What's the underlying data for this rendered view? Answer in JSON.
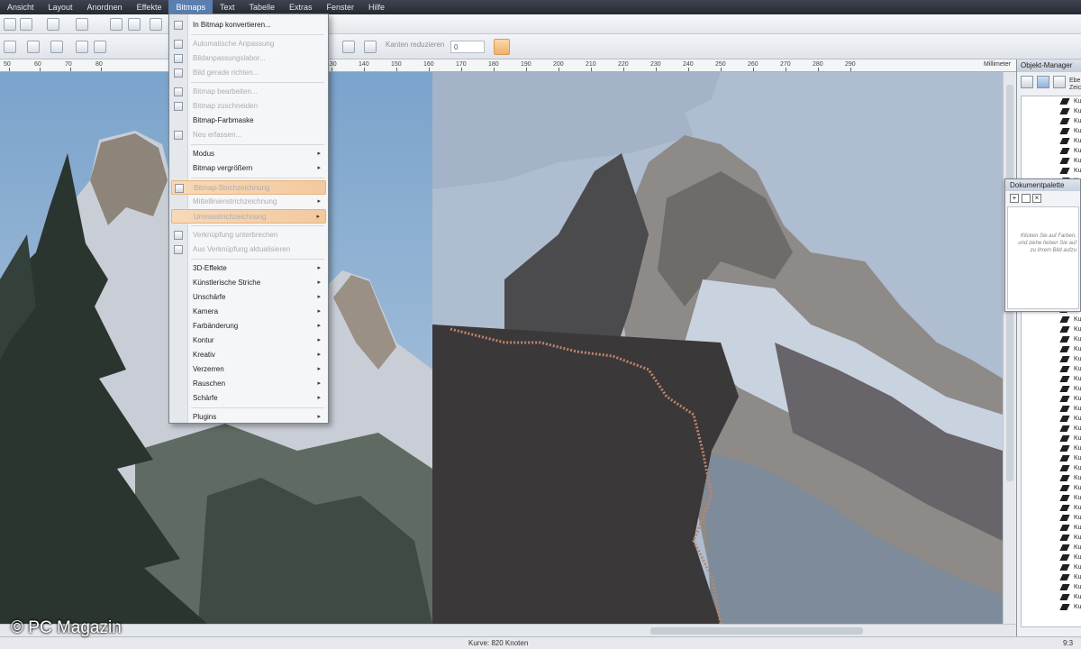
{
  "menubar": {
    "items": [
      "Ansicht",
      "Layout",
      "Anordnen",
      "Effekte",
      "Bitmaps",
      "Text",
      "Tabelle",
      "Extras",
      "Fenster",
      "Hilfe"
    ],
    "active_index": 4
  },
  "toolbar": {
    "smooth_label": "Kanten reduzieren",
    "smooth_value": "0"
  },
  "ruler": {
    "ticks": [
      "50",
      "60",
      "70",
      "80",
      "130",
      "140",
      "150",
      "160",
      "170",
      "180",
      "190",
      "200",
      "210",
      "220",
      "230",
      "240",
      "250",
      "260",
      "270",
      "280",
      "290"
    ],
    "unit": "Millimeter"
  },
  "bitmap_menu": {
    "items": [
      {
        "label": "In Bitmap konvertieren...",
        "enabled": true,
        "submenu": false,
        "icon": true
      },
      {
        "label": "Automatische Anpassung",
        "enabled": false,
        "submenu": false,
        "icon": true
      },
      {
        "label": "Bildanpassungslabor...",
        "enabled": false,
        "submenu": false,
        "icon": true
      },
      {
        "label": "Bild gerade richten...",
        "enabled": false,
        "submenu": false,
        "icon": true
      },
      {
        "label": "Bitmap bearbeiten...",
        "enabled": false,
        "submenu": false,
        "icon": true
      },
      {
        "label": "Bitmap zuschneiden",
        "enabled": false,
        "submenu": false,
        "icon": true
      },
      {
        "label": "Bitmap-Farbmaske",
        "enabled": true,
        "submenu": false,
        "icon": false
      },
      {
        "label": "Neu erfassen...",
        "enabled": false,
        "submenu": false,
        "icon": true
      },
      {
        "label": "Modus",
        "enabled": true,
        "submenu": true,
        "icon": false
      },
      {
        "label": "Bitmap vergrößern",
        "enabled": true,
        "submenu": true,
        "icon": false
      },
      {
        "label": "Bitmap-Strichzeichnung",
        "enabled": false,
        "submenu": false,
        "icon": true,
        "highlight": true
      },
      {
        "label": "Mittellinienstrichzeichnung",
        "enabled": false,
        "submenu": true,
        "icon": false
      },
      {
        "label": "Umrissstrichzeichnung",
        "enabled": false,
        "submenu": true,
        "icon": false,
        "highlight": true
      },
      {
        "label": "Verknüpfung unterbrechen",
        "enabled": false,
        "submenu": false,
        "icon": true
      },
      {
        "label": "Aus Verknüpfung aktualisieren",
        "enabled": false,
        "submenu": false,
        "icon": true
      },
      {
        "label": "3D-Effekte",
        "enabled": true,
        "submenu": true,
        "icon": false
      },
      {
        "label": "Künstlerische Striche",
        "enabled": true,
        "submenu": true,
        "icon": false
      },
      {
        "label": "Unschärfe",
        "enabled": true,
        "submenu": true,
        "icon": false
      },
      {
        "label": "Kamera",
        "enabled": true,
        "submenu": true,
        "icon": false
      },
      {
        "label": "Farbänderung",
        "enabled": true,
        "submenu": true,
        "icon": false
      },
      {
        "label": "Kontur",
        "enabled": true,
        "submenu": true,
        "icon": false
      },
      {
        "label": "Kreativ",
        "enabled": true,
        "submenu": true,
        "icon": false
      },
      {
        "label": "Verzerren",
        "enabled": true,
        "submenu": true,
        "icon": false
      },
      {
        "label": "Rauschen",
        "enabled": true,
        "submenu": true,
        "icon": false
      },
      {
        "label": "Schärfe",
        "enabled": true,
        "submenu": true,
        "icon": false
      },
      {
        "label": "Plugins",
        "enabled": true,
        "submenu": true,
        "icon": false
      }
    ]
  },
  "object_manager": {
    "title": "Objekt-Manager",
    "subtitle": "Ebe Zeic",
    "row_label": "Kur",
    "row_count": 52
  },
  "palette": {
    "title": "Dokumentpalette",
    "hint": "Klicken Sie auf Farben, und ziehe heben Sie auf zu Ihrem Bild aufzu"
  },
  "status": {
    "text": "Kurve: 820 Knoten",
    "time": "9:3"
  },
  "watermark": "© PC Magazin",
  "colors": {
    "menu_highlight": "#f3c99e",
    "menubar_bg": "#2e333c",
    "active_menu": "#5a7fb0"
  }
}
